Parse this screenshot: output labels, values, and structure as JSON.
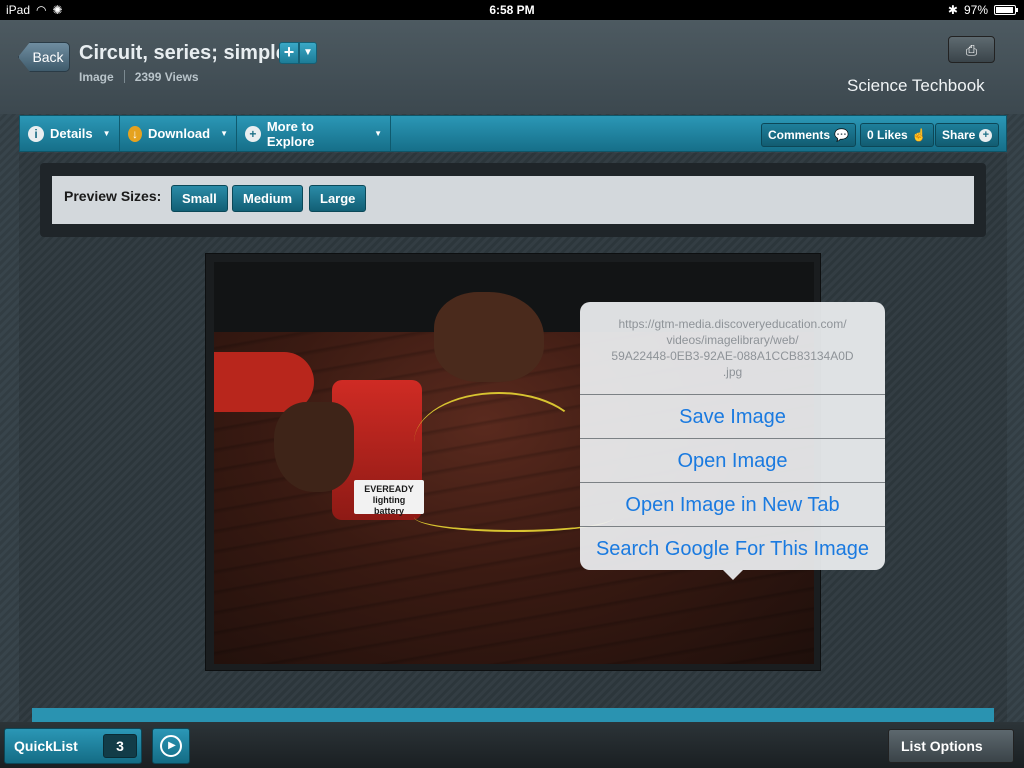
{
  "status_bar": {
    "device": "iPad",
    "time": "6:58 PM",
    "battery": "97%"
  },
  "header": {
    "back_label": "Back",
    "title": "Circuit, series; simple",
    "media_type": "Image",
    "views": "2399 Views",
    "brand": "Science Techbook",
    "print_icon": "printer-icon"
  },
  "toolbar": {
    "details": "Details",
    "download": "Download",
    "more_to_explore": "More to Explore",
    "comments": "Comments",
    "likes": "0 Likes",
    "share": "Share"
  },
  "preview": {
    "label": "Preview Sizes:",
    "sizes": [
      "Small",
      "Medium",
      "Large"
    ]
  },
  "popover": {
    "url_lines": [
      "https://gtm-media.discoveryeducation.com/",
      "videos/imagelibrary/web/",
      "59A22448-0EB3-92AE-088A1CCB83134A0D",
      ".jpg"
    ],
    "items": [
      "Save Image",
      "Open Image",
      "Open Image in New Tab",
      "Search Google For This Image"
    ]
  },
  "photo": {
    "battery_brand": "EVEREADY",
    "battery_text_1": "lighting",
    "battery_text_2": "battery"
  },
  "bottom_bar": {
    "quicklist": "QuickList",
    "quicklist_count": "3",
    "list_options": "List Options"
  }
}
